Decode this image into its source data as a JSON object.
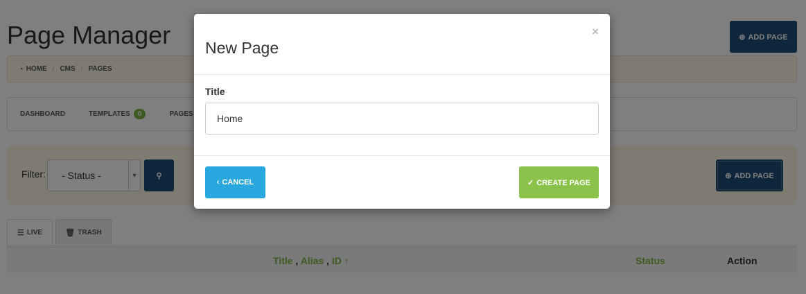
{
  "page": {
    "title": "Page Manager",
    "add_page_label": "ADD PAGE"
  },
  "breadcrumb": {
    "home": "HOME",
    "cms": "CMS",
    "pages": "PAGES"
  },
  "subnav": {
    "dashboard": "DASHBOARD",
    "templates": "TEMPLATES",
    "templates_count": "0",
    "pages": "PAGES"
  },
  "filter": {
    "label": "Filter:",
    "status_value": "- Status -",
    "add_page_label": "ADD PAGE"
  },
  "tabs": {
    "live": "LIVE",
    "trash": "TRASH"
  },
  "table": {
    "title": "Title",
    "alias": "Alias",
    "id": "ID",
    "sort_arrow": "↑",
    "status": "Status",
    "action": "Action"
  },
  "modal": {
    "title": "New Page",
    "close": "×",
    "field_label": "Title",
    "field_value": "Home",
    "cancel_label": "CANCEL",
    "create_label": "CREATE PAGE"
  },
  "colors": {
    "navy": "#1f4e79",
    "green": "#7cb342",
    "blue": "#29a8df",
    "lime": "#8bc34a"
  }
}
